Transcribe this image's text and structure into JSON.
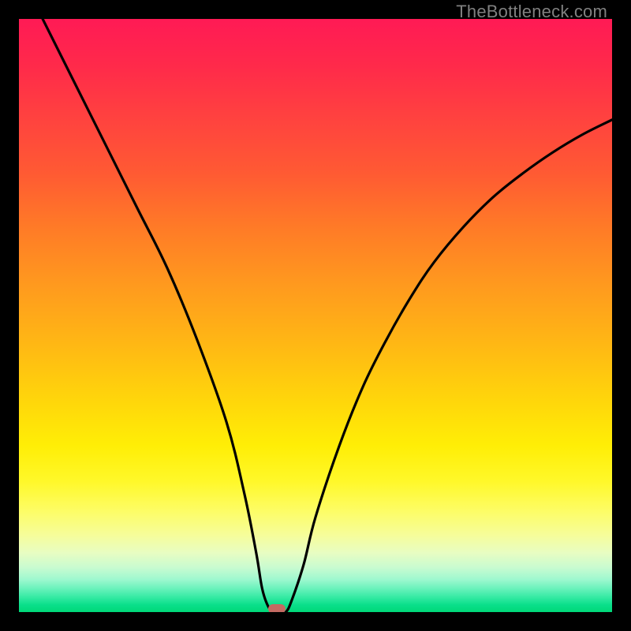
{
  "watermark": "TheBottleneck.com",
  "chart_data": {
    "type": "line",
    "title": "",
    "xlabel": "",
    "ylabel": "",
    "xlim": [
      0,
      100
    ],
    "ylim": [
      0,
      100
    ],
    "grid": false,
    "legend": false,
    "series": [
      {
        "name": "bottleneck-curve",
        "x": [
          4,
          10,
          15,
          20,
          25,
          30,
          35,
          38,
          40,
          41,
          42,
          43,
          44,
          45,
          46,
          48,
          50,
          54,
          58,
          62,
          66,
          70,
          75,
          80,
          85,
          90,
          95,
          100
        ],
        "values": [
          100,
          88,
          78,
          68,
          58,
          46,
          32,
          20,
          10,
          4,
          1,
          0,
          0,
          0,
          2,
          8,
          16,
          28,
          38,
          46,
          53,
          59,
          65,
          70,
          74,
          77.5,
          80.5,
          83
        ]
      }
    ],
    "marker": {
      "x": 43.5,
      "y": 0
    },
    "colors": {
      "curve": "#000000",
      "marker": "#c46a62",
      "gradient_top": "#ff1a55",
      "gradient_bottom": "#00d878"
    }
  }
}
